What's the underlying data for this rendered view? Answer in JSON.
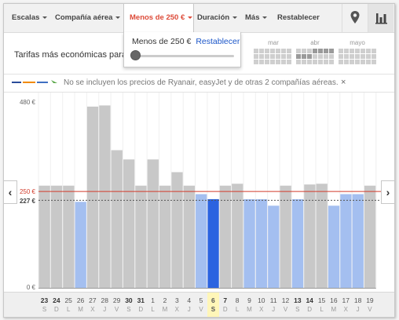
{
  "toolbar": {
    "items": [
      {
        "label": "Escalas",
        "dropdown": true
      },
      {
        "label": "Compañía aérea",
        "dropdown": true
      },
      {
        "label": "Menos de 250 €",
        "dropdown": true,
        "active": true
      },
      {
        "label": "Duración",
        "dropdown": true
      },
      {
        "label": "Más",
        "dropdown": true
      },
      {
        "label": "Restablecer",
        "dropdown": false
      }
    ],
    "icons": [
      "map-pin-icon",
      "bar-chart-icon"
    ]
  },
  "price_filter_popup": {
    "text": "Menos de 250 €",
    "reset_link": "Restablecer",
    "slider_value_fraction": 0.0
  },
  "summary": {
    "text": "Tarifas más económicas para u",
    "months": [
      "mar",
      "abr",
      "mayo"
    ]
  },
  "notice": {
    "text": "No se incluyen los precios de Ryanair, easyJet y de otras 2 compañías aéreas.",
    "close": "×"
  },
  "nav": {
    "prev": "‹",
    "next": "›"
  },
  "colors": {
    "bar_gray": "#c8c8c8",
    "bar_blue": "#a4bff0",
    "bar_selected": "#2b63e0",
    "threshold_line": "#d23c2c",
    "min_line": "#555555",
    "active_tab": "#dd4b39"
  },
  "chart_data": {
    "type": "bar",
    "ylim": [
      0,
      480
    ],
    "y_tick_labels": [
      "480 €",
      "250 €",
      "227 €",
      "0 €"
    ],
    "y_ticks": [
      480,
      250,
      227,
      0
    ],
    "threshold": 250,
    "min_price": 227,
    "categories": [
      {
        "day": "23",
        "weekday": "S",
        "bold": true
      },
      {
        "day": "24",
        "weekday": "D",
        "bold": true
      },
      {
        "day": "25",
        "weekday": "L",
        "bold": false
      },
      {
        "day": "26",
        "weekday": "M",
        "bold": false
      },
      {
        "day": "27",
        "weekday": "X",
        "bold": false
      },
      {
        "day": "28",
        "weekday": "J",
        "bold": false
      },
      {
        "day": "29",
        "weekday": "V",
        "bold": false
      },
      {
        "day": "30",
        "weekday": "S",
        "bold": true
      },
      {
        "day": "31",
        "weekday": "D",
        "bold": true
      },
      {
        "day": "1",
        "weekday": "L",
        "bold": false
      },
      {
        "day": "2",
        "weekday": "M",
        "bold": false
      },
      {
        "day": "3",
        "weekday": "X",
        "bold": false
      },
      {
        "day": "4",
        "weekday": "J",
        "bold": false
      },
      {
        "day": "5",
        "weekday": "V",
        "bold": false
      },
      {
        "day": "6",
        "weekday": "S",
        "bold": true,
        "selected": true
      },
      {
        "day": "7",
        "weekday": "D",
        "bold": true
      },
      {
        "day": "8",
        "weekday": "L",
        "bold": false
      },
      {
        "day": "9",
        "weekday": "M",
        "bold": false
      },
      {
        "day": "10",
        "weekday": "X",
        "bold": false
      },
      {
        "day": "11",
        "weekday": "J",
        "bold": false
      },
      {
        "day": "12",
        "weekday": "V",
        "bold": false
      },
      {
        "day": "13",
        "weekday": "S",
        "bold": true
      },
      {
        "day": "14",
        "weekday": "D",
        "bold": true
      },
      {
        "day": "15",
        "weekday": "L",
        "bold": false
      },
      {
        "day": "16",
        "weekday": "M",
        "bold": false
      },
      {
        "day": "17",
        "weekday": "X",
        "bold": false
      },
      {
        "day": "18",
        "weekday": "J",
        "bold": false
      },
      {
        "day": "19",
        "weekday": "V",
        "bold": false
      }
    ],
    "values": [
      265,
      265,
      265,
      223,
      470,
      473,
      357,
      333,
      265,
      333,
      265,
      300,
      265,
      243,
      230,
      265,
      270,
      230,
      230,
      213,
      265,
      230,
      268,
      270,
      213,
      243,
      243,
      265
    ],
    "bar_states": [
      "gray",
      "gray",
      "gray",
      "blue",
      "gray",
      "gray",
      "gray",
      "gray",
      "gray",
      "gray",
      "gray",
      "gray",
      "gray",
      "blue",
      "selected",
      "gray",
      "gray",
      "blue",
      "blue",
      "blue",
      "gray",
      "blue",
      "gray",
      "gray",
      "blue",
      "blue",
      "blue",
      "gray"
    ]
  }
}
